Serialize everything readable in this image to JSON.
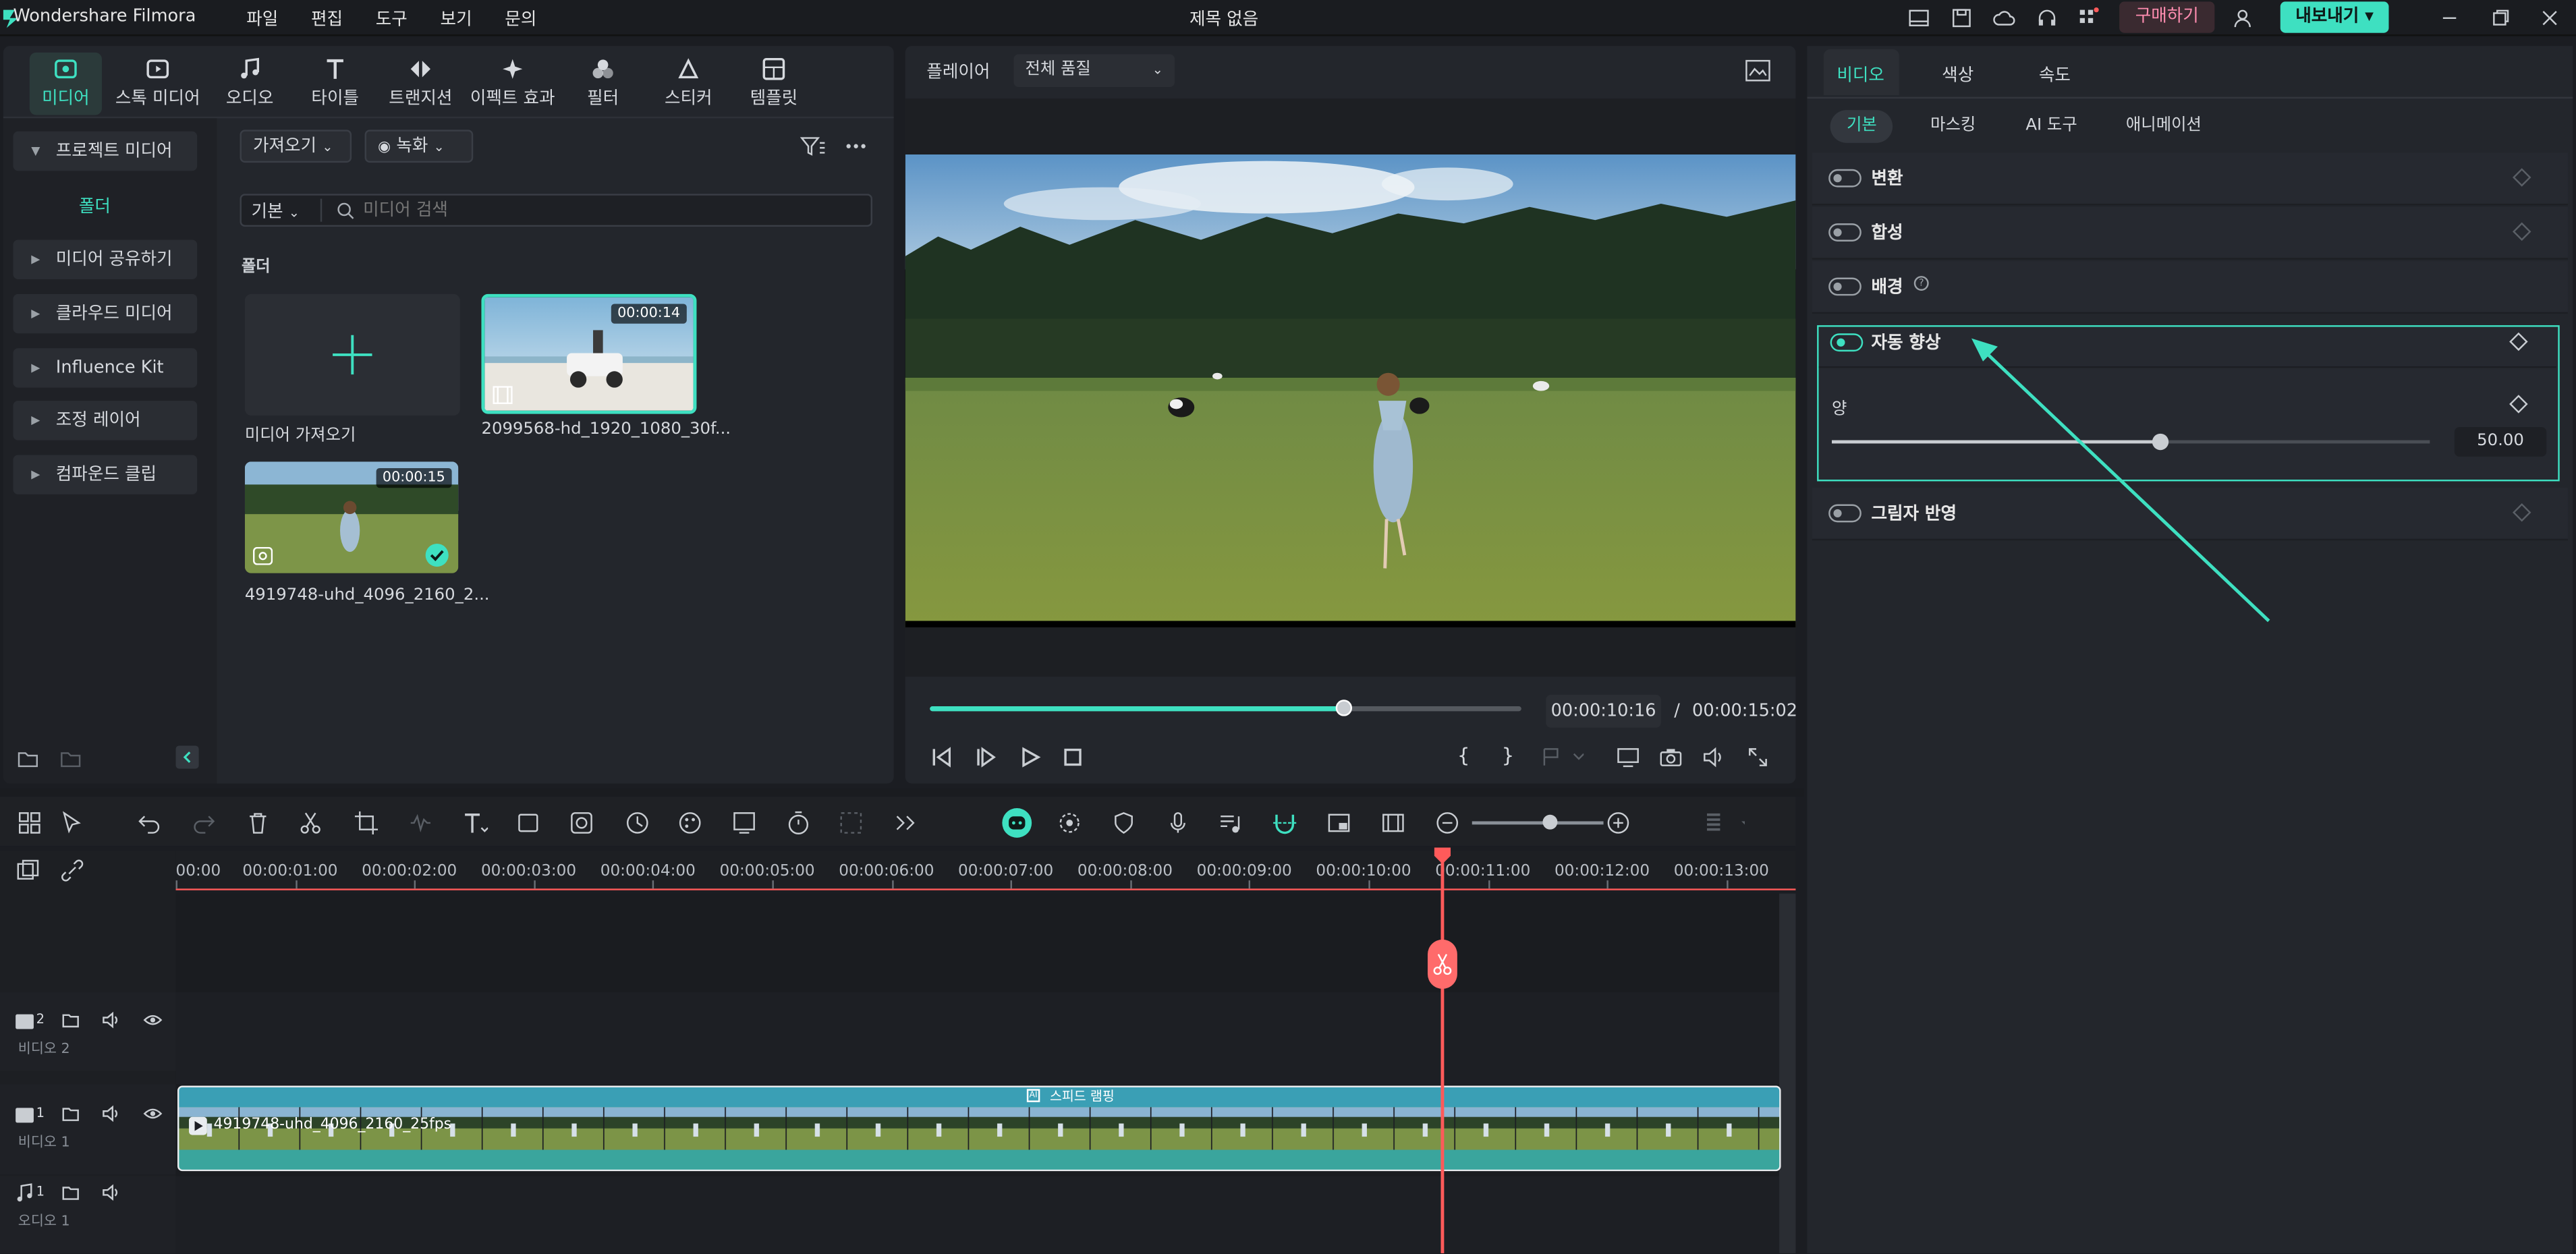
{
  "app": {
    "name": "Wondershare Filmora",
    "document_title": "제목 없음"
  },
  "menu": [
    "파일",
    "편집",
    "도구",
    "보기",
    "문의"
  ],
  "header_buttons": {
    "buy": "구매하기",
    "export": "내보내기"
  },
  "media_toolbar": [
    "미디어",
    "스톡 미디어",
    "오디오",
    "타이틀",
    "트랜지션",
    "이펙트 효과",
    "필터",
    "스티커",
    "템플릿"
  ],
  "sidebar": {
    "project_media": "프로젝트 미디어",
    "folder": "폴더",
    "items": [
      "미디어 공유하기",
      "클라우드 미디어",
      "Influence Kit",
      "조정 레이어",
      "컴파운드 클립"
    ]
  },
  "media": {
    "import_dropdown": "가져오기",
    "record_dropdown": "녹화",
    "view_select": "기본",
    "search_placeholder": "미디어 검색",
    "section_label": "폴더",
    "import_tile_label": "미디어 가져오기",
    "clips": [
      {
        "name": "2099568-hd_1920_1080_30f...",
        "duration": "00:00:14"
      },
      {
        "name": "4919748-uhd_4096_2160_2...",
        "duration": "00:00:15"
      }
    ]
  },
  "player": {
    "label": "플레이어",
    "quality": "전체 품질",
    "current_time": "00:00:10:16",
    "separator": "/",
    "total_time": "00:00:15:02",
    "progress": 0.7
  },
  "properties": {
    "tabs": [
      "비디오",
      "색상",
      "속도"
    ],
    "subtabs": [
      "기본",
      "마스킹",
      "AI 도구",
      "애니메이션"
    ],
    "rows": [
      {
        "label": "변환",
        "on": false
      },
      {
        "label": "합성",
        "on": false
      },
      {
        "label": "배경",
        "on": false
      },
      {
        "label": "자동 향상",
        "on": true
      },
      {
        "label": "그림자 반영",
        "on": false
      }
    ],
    "amount_label": "양",
    "amount_value": "50.00",
    "amount_fraction": 0.5
  },
  "timeline": {
    "ruler": [
      "00:00",
      "00:00:01:00",
      "00:00:02:00",
      "00:00:03:00",
      "00:00:04:00",
      "00:00:05:00",
      "00:00:06:00",
      "00:00:07:00",
      "00:00:08:00",
      "00:00:09:00",
      "00:00:10:00",
      "00:00:11:00",
      "00:00:12:00",
      "00:00:13:00"
    ],
    "tracks": [
      {
        "num": "2",
        "name": "비디오 2"
      },
      {
        "num": "1",
        "name": "비디오 1"
      },
      {
        "num": "1",
        "name": "오디오 1"
      }
    ],
    "clip_name": "4919748-uhd_4096_2160_25fps",
    "clip_badge": "스피드 램핑"
  },
  "colors": {
    "accent": "#3ee0c1",
    "playhead": "#ff5a5a",
    "buy": "#ff8db0"
  }
}
